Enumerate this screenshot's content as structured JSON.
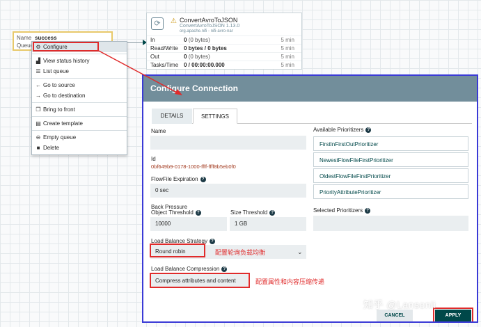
{
  "connection": {
    "name_key": "Name",
    "name_value": "success",
    "queued_key": "Queued"
  },
  "processor": {
    "name": "ConvertAvroToJSON",
    "type": "ConvertAvroToJSON 1.13.0",
    "bundle": "org.apache.nifi - nifi-avro-nar",
    "stats": [
      {
        "key": "In",
        "value": "0",
        "extra": "(0 bytes)",
        "time": "5 min"
      },
      {
        "key": "Read/Write",
        "value": "0 bytes / 0 bytes",
        "extra": "",
        "time": "5 min"
      },
      {
        "key": "Out",
        "value": "0",
        "extra": "(0 bytes)",
        "time": "5 min"
      },
      {
        "key": "Tasks/Time",
        "value": "0 / 00:00:00.000",
        "extra": "",
        "time": "5 min"
      }
    ]
  },
  "context_menu": {
    "configure": "Configure",
    "view_status_history": "View status history",
    "list_queue": "List queue",
    "go_to_source": "Go to source",
    "go_to_destination": "Go to destination",
    "bring_to_front": "Bring to front",
    "create_template": "Create template",
    "empty_queue": "Empty queue",
    "delete": "Delete"
  },
  "dialog": {
    "title": "Configure Connection",
    "tabs": [
      "DETAILS",
      "SETTINGS"
    ],
    "name_label": "Name",
    "name_value": "",
    "id_label": "Id",
    "id_value": "0bf649b9-0178-1000-ffff-ffff8b5eb0f0",
    "expiration_label": "FlowFile Expiration",
    "expiration_value": "0 sec",
    "backpressure_label": "Back Pressure",
    "object_threshold_label": "Object Threshold",
    "object_threshold_value": "10000",
    "size_threshold_label": "Size Threshold",
    "size_threshold_value": "1 GB",
    "lb_strategy_label": "Load Balance Strategy",
    "lb_strategy_value": "Round robin",
    "lb_strategy_note": "配置轮询负载均衡",
    "lb_compression_label": "Load Balance Compression",
    "lb_compression_value": "Compress attributes and content",
    "lb_compression_note": "配置属性和内容压缩传递",
    "available_prioritizers_label": "Available Prioritizers",
    "available_prioritizers": [
      "FirstInFirstOutPrioritizer",
      "NewestFlowFileFirstPrioritizer",
      "OldestFlowFileFirstPrioritizer",
      "PriorityAttributePrioritizer"
    ],
    "selected_prioritizers_label": "Selected Prioritizers",
    "cancel_label": "CANCEL",
    "apply_label": "APPLY"
  },
  "watermark": "知乎 @Lansonli",
  "colors": {
    "header": "#728e9b",
    "accent": "#004849",
    "annotation_red": "#e02b2b",
    "dialog_border": "#3a3ad6"
  }
}
